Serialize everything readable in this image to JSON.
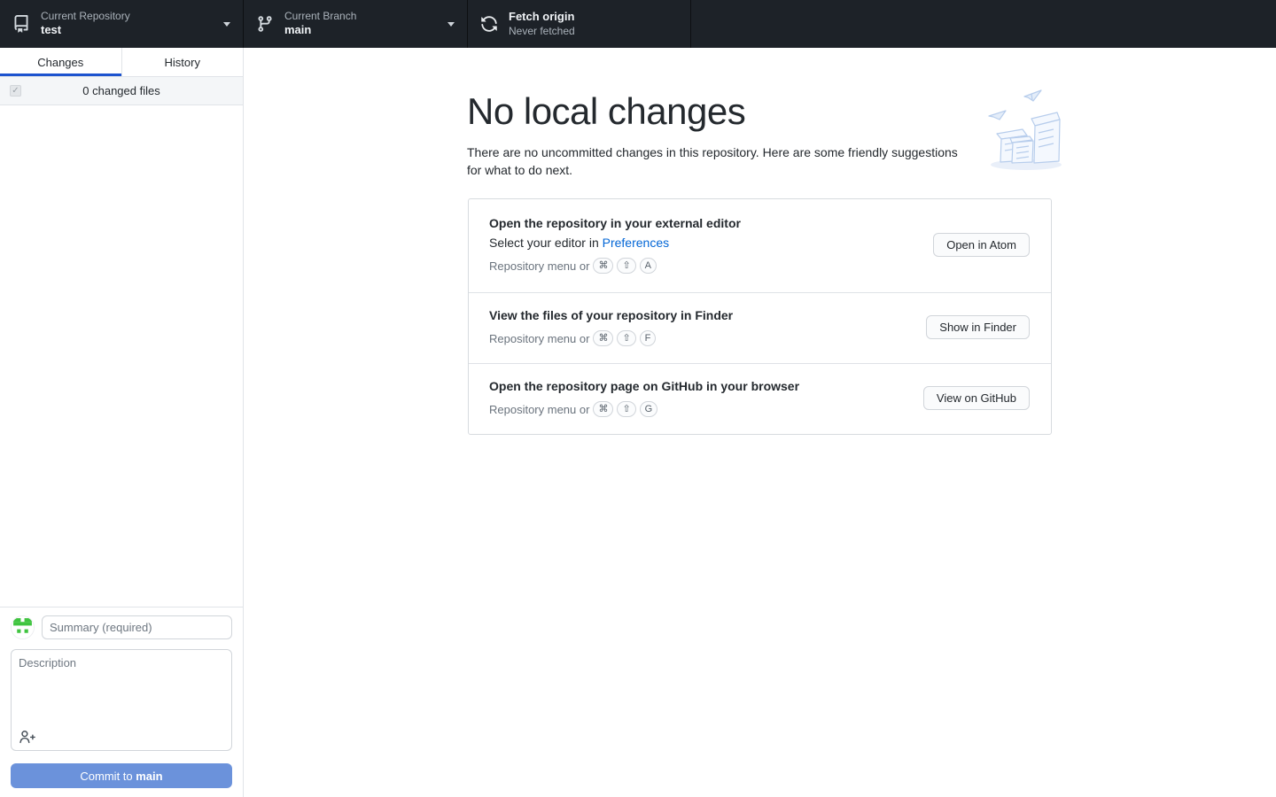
{
  "toolbar": {
    "repository": {
      "label": "Current Repository",
      "value": "test"
    },
    "branch": {
      "label": "Current Branch",
      "value": "main"
    },
    "fetch": {
      "label": "Fetch origin",
      "value": "Never fetched"
    }
  },
  "sidebar": {
    "tabs": [
      {
        "label": "Changes",
        "active": true
      },
      {
        "label": "History",
        "active": false
      }
    ],
    "changed_files": "0 changed files",
    "checkbox_glyph": "✓",
    "commit": {
      "summary_placeholder": "Summary (required)",
      "description_placeholder": "Description",
      "button_prefix": "Commit to ",
      "button_branch": "main"
    }
  },
  "main": {
    "title": "No local changes",
    "subtitle": "There are no uncommitted changes in this repository. Here are some friendly suggestions for what to do next.",
    "suggestions": [
      {
        "title": "Open the repository in your external editor",
        "line2_prefix": "Select your editor in ",
        "line2_link": "Preferences",
        "shortcut_prefix": "Repository menu or",
        "keys": [
          "⌘",
          "⇧",
          "A"
        ],
        "button": "Open in Atom"
      },
      {
        "title": "View the files of your repository in Finder",
        "shortcut_prefix": "Repository menu or",
        "keys": [
          "⌘",
          "⇧",
          "F"
        ],
        "button": "Show in Finder"
      },
      {
        "title": "Open the repository page on GitHub in your browser",
        "shortcut_prefix": "Repository menu or",
        "keys": [
          "⌘",
          "⇧",
          "G"
        ],
        "button": "View on GitHub"
      }
    ]
  },
  "colors": {
    "toolbar_bg": "#1d2228",
    "tab_underline": "#1d53cf",
    "link_blue": "#0366d6",
    "commit_button": "#6b92db",
    "identicon_green": "#3fc43f",
    "illustration_stroke": "#b7cdec"
  }
}
